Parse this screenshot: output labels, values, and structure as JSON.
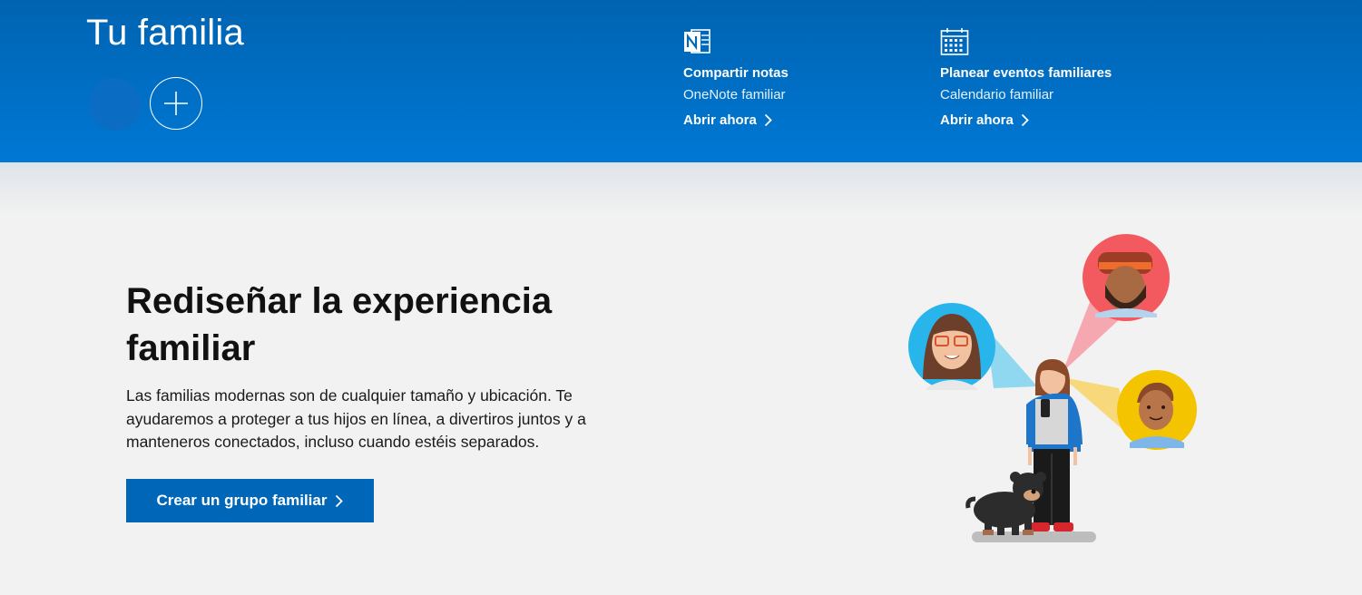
{
  "header": {
    "title": "Tu familia",
    "accent": "#0078d4",
    "promos": [
      {
        "icon": "onenote-icon",
        "title": "Compartir notas",
        "subtitle": "OneNote familiar",
        "link": "Abrir ahora"
      },
      {
        "icon": "calendar-icon",
        "title": "Planear eventos familiares",
        "subtitle": "Calendario familiar",
        "link": "Abrir ahora"
      }
    ]
  },
  "hero": {
    "title_line1": "Rediseñar la experiencia",
    "title_line2": "familiar",
    "body": "Las familias modernas son de cualquier tamaño y ubicación. Te ayudaremos a proteger a tus hijos en línea, a divertiros juntos y a manteneros conectados, incluso cuando estéis separados.",
    "cta_label": "Crear un grupo familiar",
    "cta_color": "#0067b8"
  }
}
